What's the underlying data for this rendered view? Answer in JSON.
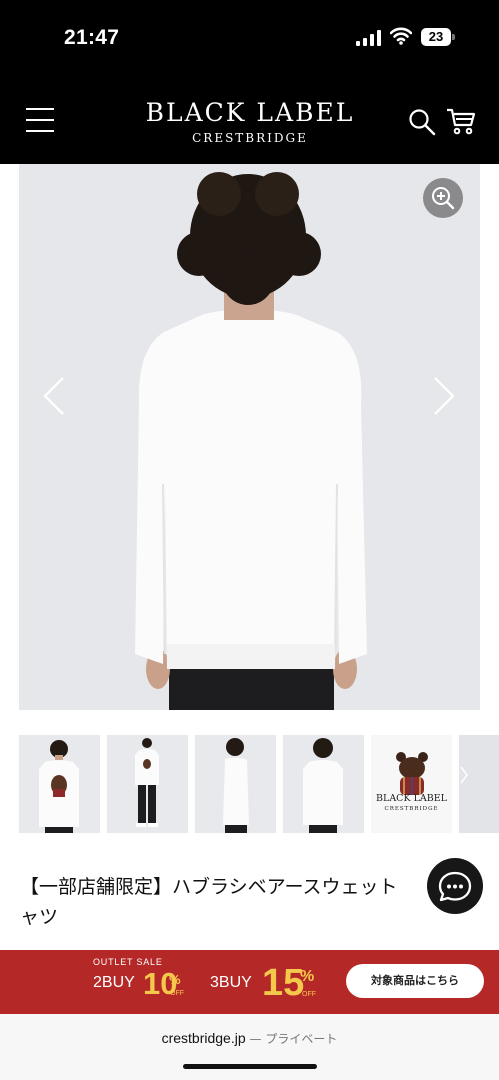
{
  "status_bar": {
    "time": "21:47",
    "battery_level": "23",
    "icons": [
      "signal-icon",
      "wifi-icon",
      "battery-icon"
    ]
  },
  "header": {
    "logo_main": "BLACK LABEL",
    "logo_sub": "CRESTBRIDGE",
    "icons": [
      "menu-icon",
      "search-icon",
      "cart-icon"
    ],
    "background": "#000000"
  },
  "gallery": {
    "icons": [
      "zoom-in-icon",
      "chevron-left-icon",
      "chevron-right-icon"
    ],
    "thumbnail_count_visible": 5,
    "thumbnail_logo_main": "BLACK LABEL",
    "thumbnail_logo_sub": "CRESTBRIDGE"
  },
  "product": {
    "title": "【一部店舗限定】ハブラシベアースウェットシャツ",
    "title_line1": "【一部店舗限定】ハブラシベアースウェット",
    "title_line2": "ャツ"
  },
  "chat": {
    "icon": "chat-icon"
  },
  "banner": {
    "label": "OUTLET SALE",
    "deal1_prefix": "2BUY",
    "deal1_value": "10",
    "deal1_pct": "%",
    "deal1_off": "OFF",
    "deal2_prefix": "3BUY",
    "deal2_value": "15",
    "deal2_pct": "%",
    "deal2_off": "OFF",
    "cta": "対象商品はこちら",
    "background": "#b52828",
    "accent": "#f4c84a"
  },
  "footer": {
    "url": "crestbridge.jp",
    "separator": "—",
    "mode": "プライベート"
  }
}
